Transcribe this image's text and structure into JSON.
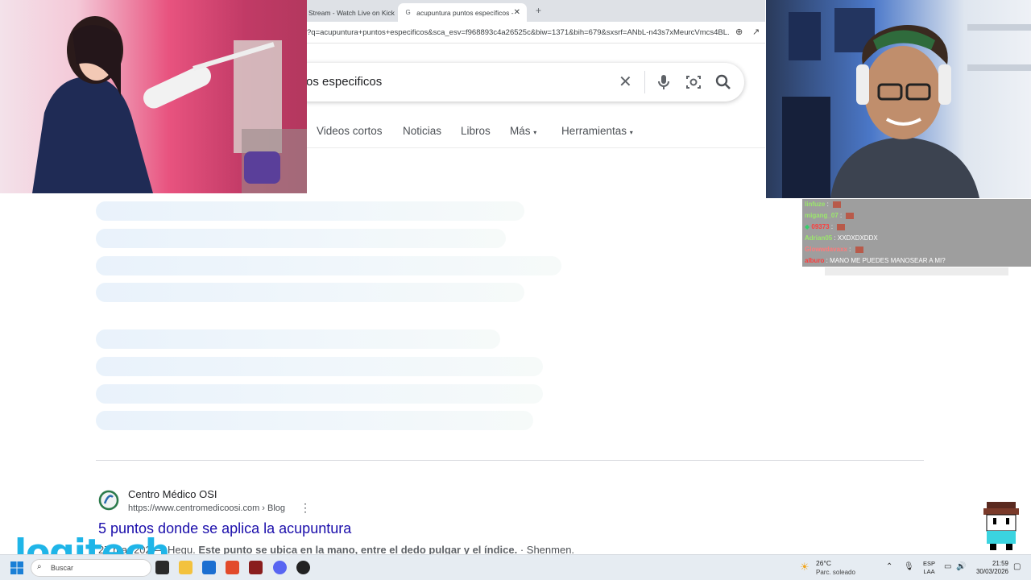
{
  "browser": {
    "tabs": [
      {
        "title": "Stream - Watch Live on Kick",
        "active": false
      },
      {
        "title": "acupuntura puntos específicos -",
        "active": true
      }
    ],
    "url": "?q=acupuntura+puntos+especificos&sca_esv=f968893c4a26525c&biw=1371&bih=679&sxsrf=ANbL-n43s7xMeurcVmcs4BL..."
  },
  "search": {
    "query_visible": "os especificos",
    "nav_tabs": [
      "Videos cortos",
      "Noticias",
      "Libros",
      "Más",
      "Herramientas"
    ]
  },
  "result": {
    "site_name": "Centro Médico OSI",
    "site_url": "https://www.centromedicoosi.com › Blog",
    "title": "5 puntos donde se aplica la acupuntura",
    "snippet_date": "27 mar 202",
    "snippet_lead": "— Hegu.",
    "snippet_bold": "Este punto se ubica en la mano, entre el dedo pulgar y el índice.",
    "snippet_tail": "· Shenmen."
  },
  "chat": [
    {
      "user": "linfuze",
      "message": "",
      "user_color": "#9be86b",
      "emote": true
    },
    {
      "user": "migang_07",
      "message": "",
      "user_color": "#9be86b",
      "emote": true
    },
    {
      "user": "09373",
      "message": "",
      "user_color": "#ff3b3b",
      "emote": true
    },
    {
      "user": "Adrian05",
      "message": "XXDXDXDDX",
      "user_color": "#9be86b",
      "emote": false
    },
    {
      "user": "Glowwdavaxx",
      "message": "",
      "user_color": "#ff7a7a",
      "emote": true
    },
    {
      "user": "alburo",
      "message": "MANO ME PUEDES MANOSEAR A MI?",
      "user_color": "#ff3b3b",
      "emote": false
    }
  ],
  "overlay": {
    "brand": "logitech"
  },
  "taskbar": {
    "search_label": "Buscar",
    "weather_temp": "26°C",
    "weather_desc": "Parc. soleado",
    "lang_top": "ESP",
    "lang_bottom": "LAA",
    "time": "21:59",
    "date": "30/03/2026"
  }
}
